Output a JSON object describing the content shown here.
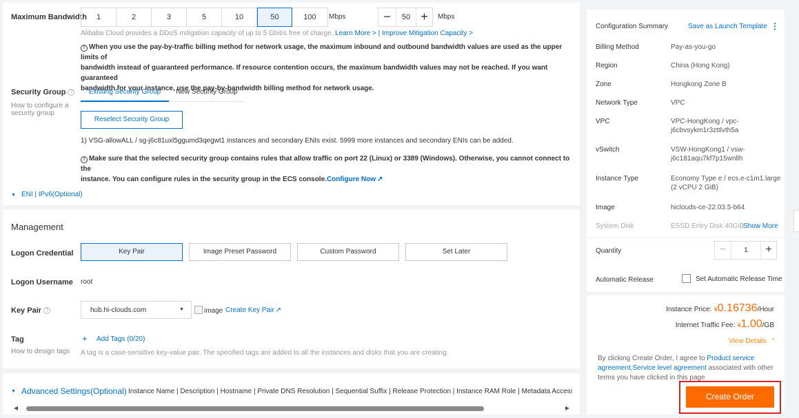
{
  "bandwidth": {
    "label": "Maximum Bandwidth",
    "options": [
      "1",
      "2",
      "3",
      "5",
      "10",
      "50",
      "100"
    ],
    "selected": "50",
    "unit": "Mbps",
    "stepper_value": "50",
    "stepper_unit": "Mbps",
    "ddos_text": "Alibaba Cloud provides a DDoS mitigation capacity of up to 5 Gbit/s free of charge.",
    "learn_more": "Learn More >",
    "improve_link": "Improve Mitigation Capacity >",
    "sep": "|",
    "warning_line1": "When you use the pay-by-traffic billing method for network usage, the maximum inbound and outbound bandwidth values are used as the upper limits of",
    "warning_line2": "bandwidth instead of guaranteed performance. If resource contention occurs, the maximum bandwidth values may not be reached. If you want guaranteed",
    "warning_line3": "bandwidth for your instance, use the pay-by-bandwidth billing method for network usage."
  },
  "security_group": {
    "label": "Security Group",
    "help": "How to configure a security group",
    "tab_existing": "Existing Security Group",
    "tab_new": "New Security Group",
    "reselect": "Reselect Security Group",
    "info": "1) VSG-allowALL / sg-j6c81uxl5ggumd3qegwt1 instances and secondary ENIs exist. 5999 more instances and secondary ENIs can be added.",
    "note_line1": "Make sure that the selected security group contains rules that allow traffic on port 22 (Linux) or 3389 (Windows). Otherwise, you cannot connect to the",
    "note_line2": "instance. You can configure rules in the security group in the ECS console.",
    "configure_now": "Configure Now"
  },
  "eni": {
    "label": "ENI | IPv6(Optional)"
  },
  "management": {
    "title": "Management",
    "logon_credential_label": "Logon Credential",
    "credentials": [
      "Key Pair",
      "Image Preset Password",
      "Custom Password",
      "Set Later"
    ],
    "logon_username_label": "Logon Username",
    "logon_username": "root",
    "key_pair_label": "Key Pair",
    "key_pair_value": "hub.hi-clouds.com",
    "image_alt": "image",
    "create_key_pair": "Create Key Pair",
    "tag_label": "Tag",
    "tag_help": "How to design tags",
    "add_tags": "Add Tags (0/20)",
    "tag_desc": "A tag is a case-sensitive key-value pair. The specified tags are added to all the instances and disks that you are creating."
  },
  "advanced": {
    "title": "Advanced Settings(Optional)",
    "items": "Instance Name | Description | Hostname | Private DNS Resolution | Sequential Suffix | Release Protection | Instance RAM Role | Metadata Access Mo"
  },
  "summary": {
    "title": "Configuration Summary",
    "save_template": "Save as Launch Template",
    "rows": [
      {
        "label": "Billing Method",
        "value": "Pay-as-you-go"
      },
      {
        "label": "Region",
        "value": "China (Hong Kong)"
      },
      {
        "label": "Zone",
        "value": "Hongkong Zone B"
      },
      {
        "label": "Network Type",
        "value": "VPC"
      },
      {
        "label": "VPC",
        "value": "VPC-HongKong / vpc-j6cbvsykm1r3zttlvth5a"
      },
      {
        "label": "vSwitch",
        "value": "VSW-HongKong1 / vsw-j6c181aqu7kf7p15wnllh"
      },
      {
        "label": "Instance Type",
        "value": "Economy Type e / ecs.e-c1m1.large (2 vCPU 2 GiB)"
      },
      {
        "label": "Image",
        "value": "hiclouds-ce-22.03.5-b64"
      },
      {
        "label": "System Disk",
        "value": "ESSD Entry Disk 40GiB"
      }
    ],
    "show_more": "Show More",
    "quantity_label": "Quantity",
    "quantity": "1",
    "auto_release_label": "Automatic Release",
    "auto_release_checkbox": "Set Automatic Release Time",
    "instance_price_label": "Instance Price:",
    "instance_price_currency": "¥",
    "instance_price": "0.16736",
    "instance_price_unit": "/Hour",
    "traffic_fee_label": "Internet Traffic Fee:",
    "traffic_fee_currency": "¥",
    "traffic_fee": "1.00",
    "traffic_fee_unit": "/GB",
    "view_details": "View Details",
    "agreement_prefix": "By clicking Create Order, I agree to",
    "product_service": "Product service",
    "agreement_link": "agreement,Service level agreement",
    "agreement_suffix": "associated with other",
    "agreement_line3": "terms you have clicked in this page",
    "create_order": "Create Order"
  },
  "colors": {
    "accent": "#0070cc",
    "orange": "#ff6a00",
    "highlight": "#e02020"
  }
}
